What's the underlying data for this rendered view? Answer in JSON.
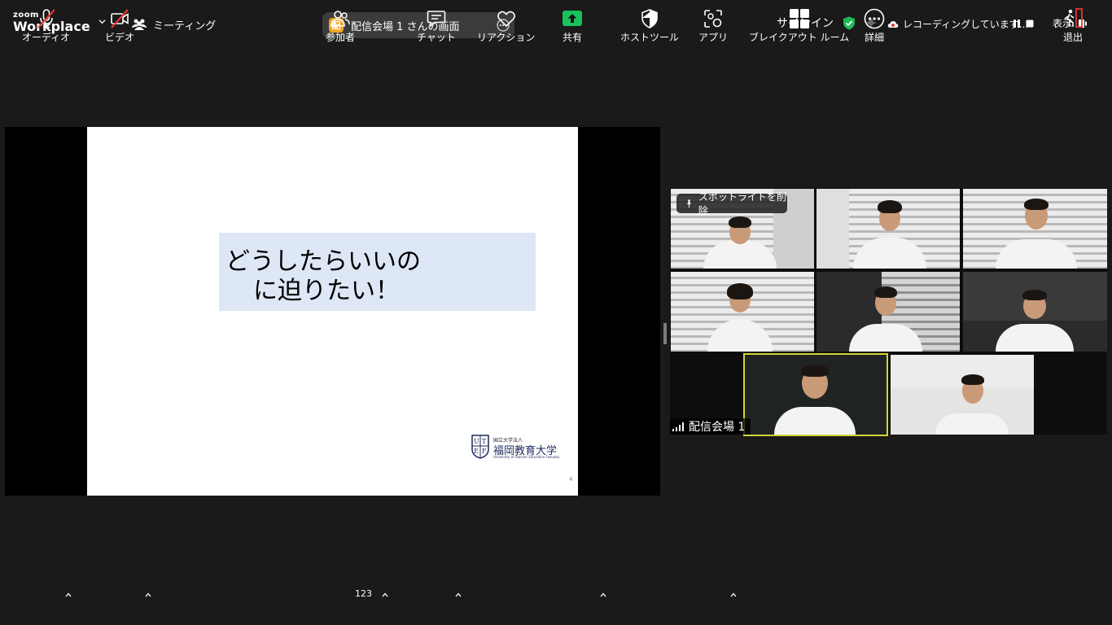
{
  "app": {
    "brand_top": "zoom",
    "brand_name": "Workplace"
  },
  "header": {
    "meeting_label": "ミーティング",
    "share_badge": "配",
    "share_title": "配信会場 1 さんの画面",
    "signin": "サインイン",
    "recording_text": "レコーディングしています...",
    "view_label": "表示"
  },
  "slide": {
    "line1": "どうしたらいいの",
    "line2": "に迫りたい！",
    "univ_small": "国立大学法人",
    "univ_name": "福岡教育大学",
    "univ_english": "University of Teacher Education Fukuoka",
    "page_number": "4"
  },
  "gallery": {
    "spotlight_button": "スポットライトを削除",
    "active_speaker_label": "配信会場 1"
  },
  "toolbar": {
    "audio": "オーディオ",
    "video": "ビデオ",
    "participants": "参加者",
    "participant_count": "123",
    "chat": "チャット",
    "reactions": "リアクション",
    "share": "共有",
    "host_tools": "ホストツール",
    "apps": "アプリ",
    "breakout": "ブレイクアウト ルーム",
    "more": "詳細",
    "leave": "退出"
  },
  "colors": {
    "share_green": "#19c25a",
    "leave_red": "#e53935",
    "muted_red": "#e53935",
    "active_speaker": "#d4d336",
    "shield_green": "#1db954",
    "app_badge": "#f0a51e"
  }
}
